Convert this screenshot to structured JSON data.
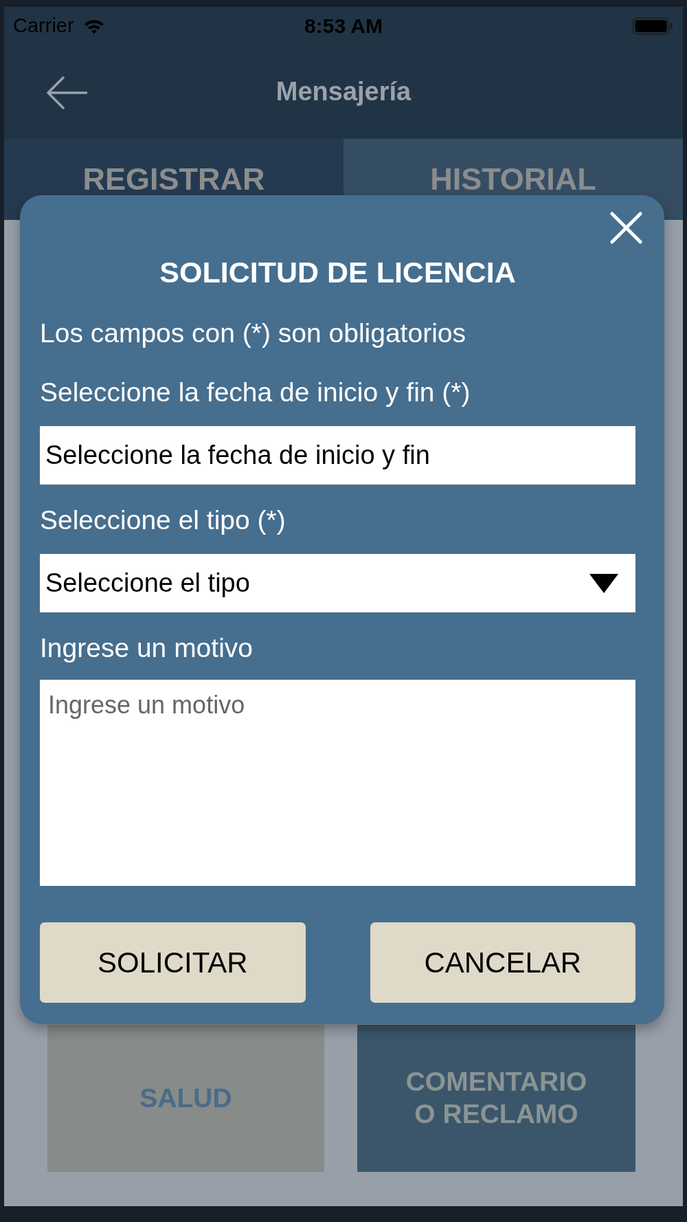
{
  "status_bar": {
    "carrier": "Carrier",
    "time": "8:53 AM"
  },
  "header": {
    "title": "Mensajería"
  },
  "tabs": [
    {
      "label": "REGISTRAR",
      "selected": true
    },
    {
      "label": "HISTORIAL",
      "selected": false
    }
  ],
  "cards": [
    {
      "label": "SALUD",
      "color": "#878b8a"
    },
    {
      "label": "COMENTARIO O RECLAMO",
      "color": "#3b566b"
    }
  ],
  "dialog": {
    "title": "SOLICITUD DE LICENCIA",
    "note": "Los campos con (*) son obligatorios",
    "fields": [
      {
        "kind": "date",
        "label": "Seleccione la fecha de inicio y fin (*)",
        "value": "Seleccione la fecha de inicio y fin"
      },
      {
        "kind": "select",
        "label": "Seleccione el tipo (*)",
        "value": "Seleccione el tipo"
      },
      {
        "kind": "textarea",
        "label": "Ingrese un motivo",
        "placeholder": "Ingrese un motivo"
      }
    ],
    "buttons": [
      "SOLICITAR",
      "CANCELAR"
    ]
  }
}
